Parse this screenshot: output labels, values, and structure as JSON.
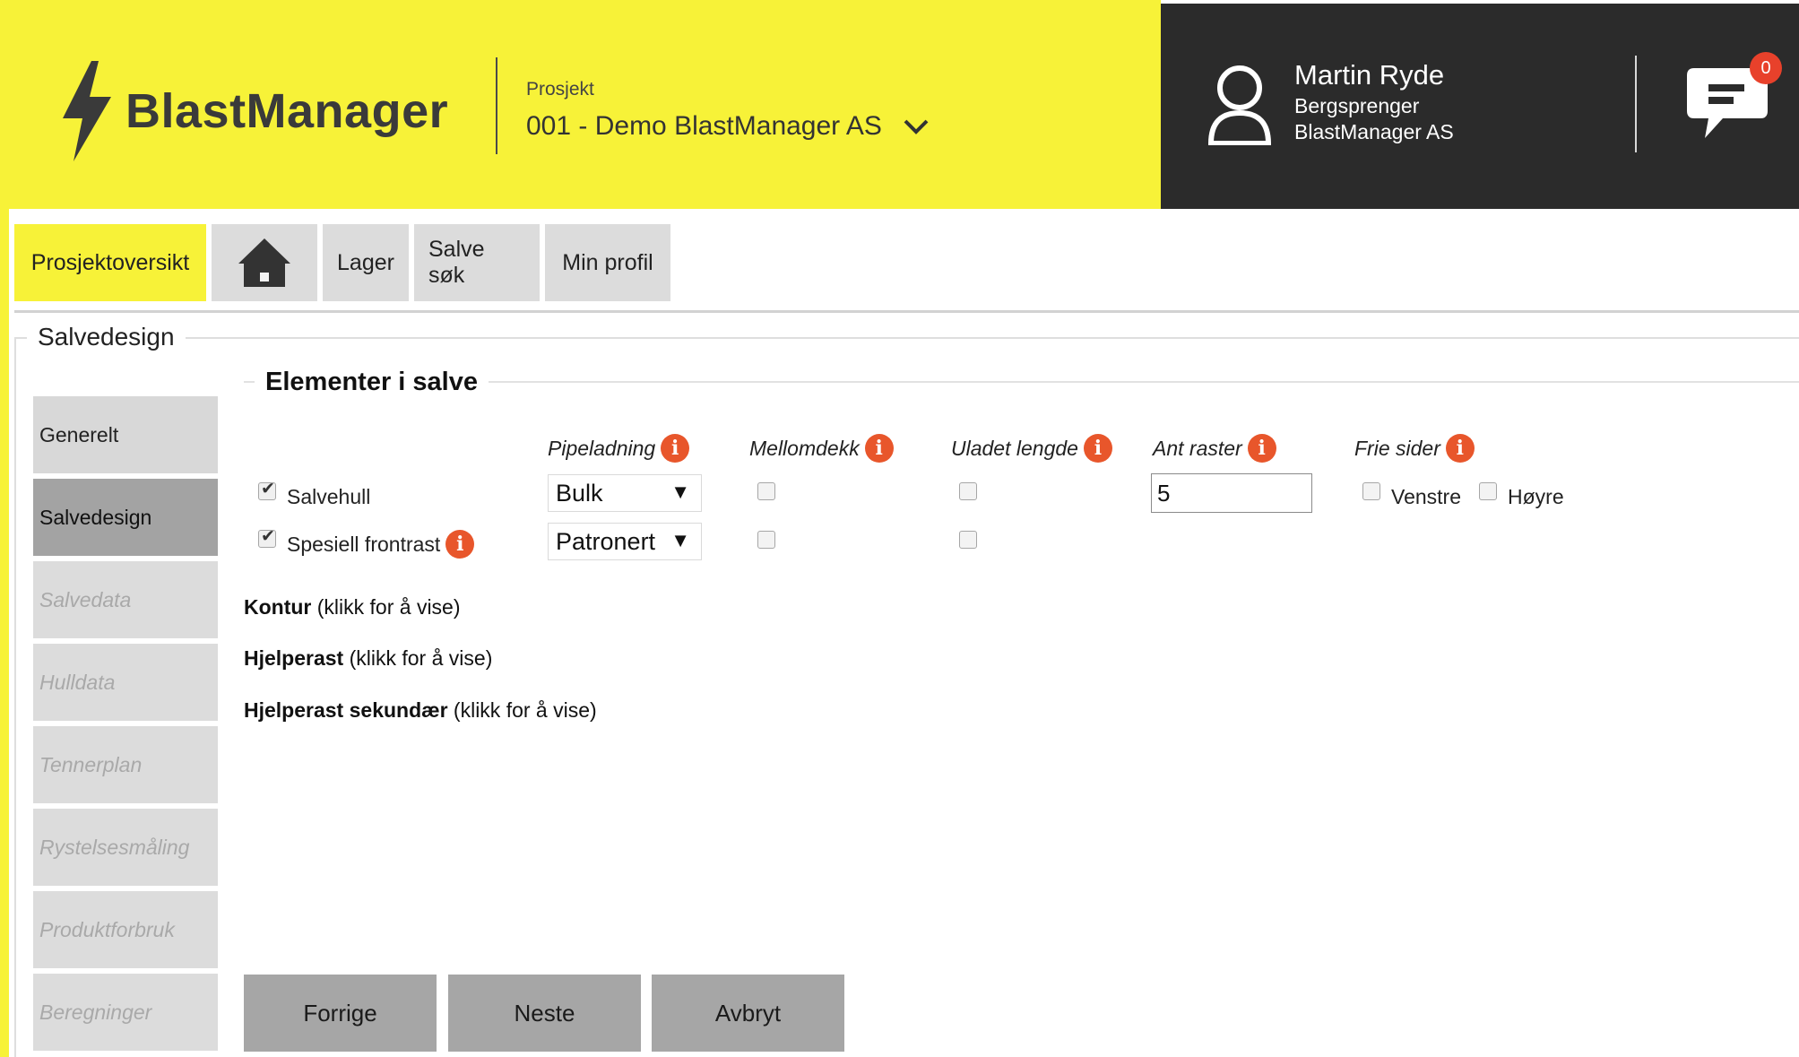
{
  "app": {
    "name": "BlastManager",
    "colors": {
      "brand_yellow": "#f7f238",
      "header_dark": "#2b2b2b",
      "info_orange": "#e8562b",
      "badge_red": "#e8412b"
    }
  },
  "header": {
    "project_label": "Prosjekt",
    "project_value": "001 - Demo BlastManager AS",
    "user": {
      "name": "Martin Ryde",
      "role": "Bergsprenger",
      "company": "BlastManager AS"
    },
    "chat_badge": "0",
    "icons": {
      "logo": "lightning-bolt-icon",
      "dropdown": "chevron-down-icon",
      "user": "user-icon",
      "chat": "chat-icon"
    }
  },
  "nav": {
    "tabs": [
      {
        "label": "Prosjektoversikt",
        "active": true
      },
      {
        "label": "",
        "icon": "home-icon"
      },
      {
        "label": "Lager"
      },
      {
        "label": "Salve søk"
      },
      {
        "label": "Min profil"
      }
    ]
  },
  "section": {
    "legend": "Salvedesign"
  },
  "sidebar": {
    "items": [
      {
        "label": "Generelt",
        "state": "enabled"
      },
      {
        "label": "Salvedesign",
        "state": "selected"
      },
      {
        "label": "Salvedata",
        "state": "disabled"
      },
      {
        "label": "Hulldata",
        "state": "disabled"
      },
      {
        "label": "Tennerplan",
        "state": "disabled"
      },
      {
        "label": "Rystelsesmåling",
        "state": "disabled"
      },
      {
        "label": "Produktforbruk",
        "state": "disabled"
      },
      {
        "label": "Beregninger",
        "state": "disabled"
      }
    ]
  },
  "elements": {
    "legend": "Elementer i salve",
    "columns": [
      "Pipeladning",
      "Mellomdekk",
      "Uladet lengde",
      "Ant raster",
      "Frie sider"
    ],
    "info_symbol": "i",
    "rows": [
      {
        "label": "Salvehull",
        "checked": true,
        "pipeladning": "Bulk",
        "mellomdekk": false,
        "uladet_lengde": false,
        "ant_raster": "5",
        "venstre": false,
        "hoyre": false
      },
      {
        "label": "Spesiell frontrast",
        "checked": true,
        "pipeladning": "Patronert",
        "mellomdekk": false,
        "uladet_lengde": false
      }
    ],
    "frie_sider_options": [
      "Venstre",
      "Høyre"
    ],
    "select_arrow": "▼"
  },
  "links": [
    {
      "bold": "Kontur",
      "hint": "(klikk for å vise)"
    },
    {
      "bold": "Hjelperast",
      "hint": "(klikk for å vise)"
    },
    {
      "bold": "Hjelperast sekundær",
      "hint": "(klikk for å vise)"
    }
  ],
  "buttons": {
    "prev": "Forrige",
    "next": "Neste",
    "cancel": "Avbryt"
  }
}
